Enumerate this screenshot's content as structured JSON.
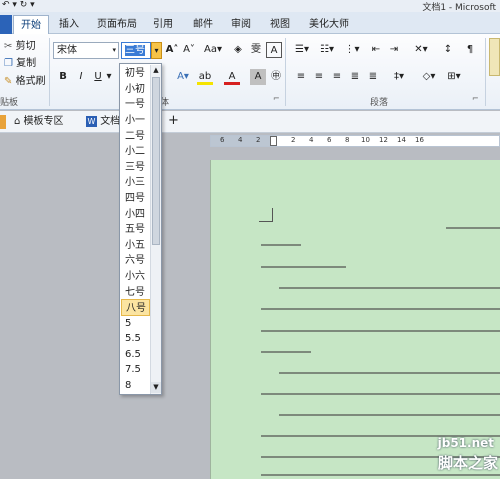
{
  "titlebar": {
    "title": "文档1 - Microsoft"
  },
  "tabs": [
    "开始",
    "插入",
    "页面布局",
    "引用",
    "邮件",
    "审阅",
    "视图",
    "美化大师"
  ],
  "clipboard": {
    "cut": "剪切",
    "copy": "复制",
    "format_painter": "格式刷",
    "label": "贴板"
  },
  "font": {
    "name": "宋体",
    "size": "三号",
    "group_label": "体"
  },
  "paragraph": {
    "group_label": "段落"
  },
  "doctabs": {
    "templates": "模板专区",
    "doc": "文档"
  },
  "ruler": {
    "numbers": [
      "6",
      "4",
      "2",
      "2",
      "4",
      "6",
      "8",
      "10",
      "12",
      "14",
      "16"
    ]
  },
  "font_sizes": [
    "初号",
    "小初",
    "一号",
    "小一",
    "二号",
    "小二",
    "三号",
    "小三",
    "四号",
    "小四",
    "五号",
    "小五",
    "六号",
    "小六",
    "七号",
    "八号",
    "5",
    "5.5",
    "6.5",
    "7.5",
    "8"
  ],
  "selected_size": "八号",
  "watermark": {
    "line1": "jb51.net",
    "line2": "脚本之家"
  }
}
